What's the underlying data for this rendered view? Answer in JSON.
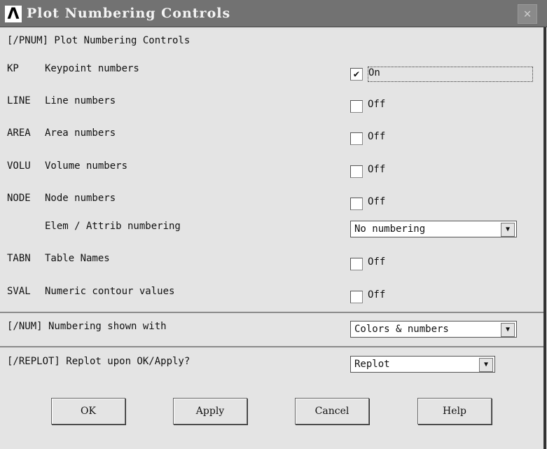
{
  "window": {
    "title": "Plot Numbering Controls",
    "close": "✕"
  },
  "header": "[/PNUM]  Plot Numbering Controls",
  "rows": [
    {
      "code": "KP",
      "label": "Keypoint numbers",
      "checked": true,
      "state": "On"
    },
    {
      "code": "LINE",
      "label": "Line numbers",
      "checked": false,
      "state": "Off"
    },
    {
      "code": "AREA",
      "label": "Area numbers",
      "checked": false,
      "state": "Off"
    },
    {
      "code": "VOLU",
      "label": "Volume numbers",
      "checked": false,
      "state": "Off"
    },
    {
      "code": "NODE",
      "label": "Node numbers",
      "checked": false,
      "state": "Off"
    }
  ],
  "elem": {
    "label": "Elem / Attrib numbering",
    "value": "No numbering"
  },
  "rows2": [
    {
      "code": "TABN",
      "label": "Table Names",
      "checked": false,
      "state": "Off"
    },
    {
      "code": "SVAL",
      "label": "Numeric contour values",
      "checked": false,
      "state": "Off"
    }
  ],
  "num": {
    "label": "[/NUM]  Numbering shown with",
    "value": "Colors & numbers"
  },
  "replot": {
    "label": "[/REPLOT] Replot upon OK/Apply?",
    "value": "Replot"
  },
  "buttons": {
    "ok": "OK",
    "apply": "Apply",
    "cancel": "Cancel",
    "help": "Help"
  },
  "check_mark": "✔",
  "arrow": "▼"
}
